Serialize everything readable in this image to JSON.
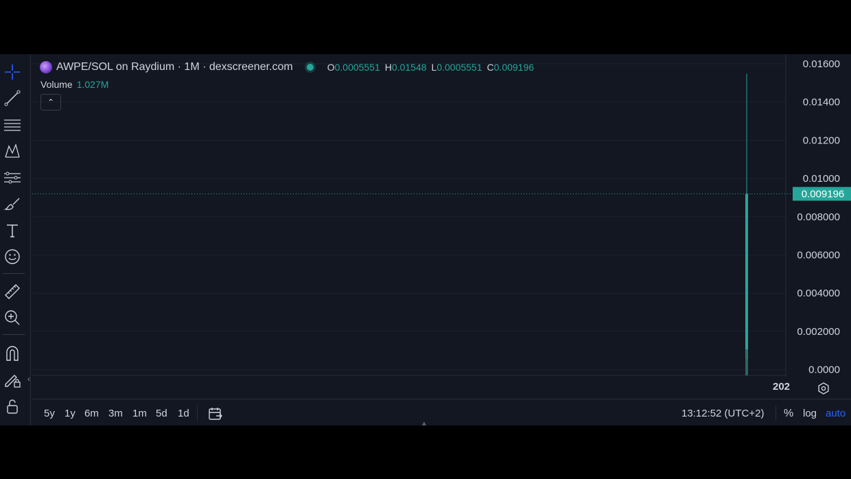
{
  "legend": {
    "title": "AWPE/SOL on Raydium · 1M · dexscreener.com",
    "ohlc": [
      {
        "key": "O",
        "value": "0.0005551"
      },
      {
        "key": "H",
        "value": "0.01548"
      },
      {
        "key": "L",
        "value": "0.0005551"
      },
      {
        "key": "C",
        "value": "0.009196"
      }
    ]
  },
  "volume": {
    "label": "Volume",
    "value": "1.027M"
  },
  "bottom_axis_label": "202",
  "ranges": [
    "5y",
    "1y",
    "6m",
    "3m",
    "1m",
    "5d",
    "1d"
  ],
  "timeinfo": "13:12:52 (UTC+2)",
  "scale_buttons": {
    "percent": "%",
    "log": "log",
    "auto": "auto"
  },
  "colors": {
    "up": "#26a69a",
    "background": "#131722",
    "grid": "#1e2230",
    "auto_active": "#2962ff"
  },
  "icons": [
    "crosshair-icon",
    "trendline-icon",
    "fib-icon",
    "pattern-icon",
    "prediction-icon",
    "brush-icon",
    "text-icon",
    "emoji-icon",
    "ruler-icon",
    "zoom-icon",
    "magnet-icon",
    "lock-drawing-icon",
    "unlock-icon",
    "settings-icon",
    "calendar-icon"
  ],
  "chart_data": {
    "type": "candlestick",
    "ylim": [
      -0.0003,
      0.0165
    ],
    "yticks": [
      "0.01600",
      "0.01400",
      "0.01200",
      "0.01000",
      "0.008000",
      "0.006000",
      "0.004000",
      "0.002000",
      "0.0000"
    ],
    "ytick_values": [
      0.016,
      0.014,
      0.012,
      0.01,
      0.008,
      0.006,
      0.004,
      0.002,
      0.0
    ],
    "last_price": {
      "label": "0.009196",
      "value": 0.009196
    },
    "candles": [
      {
        "open": 0.0005551,
        "high": 0.01548,
        "low": 0.0005551,
        "close": 0.009196
      }
    ]
  }
}
